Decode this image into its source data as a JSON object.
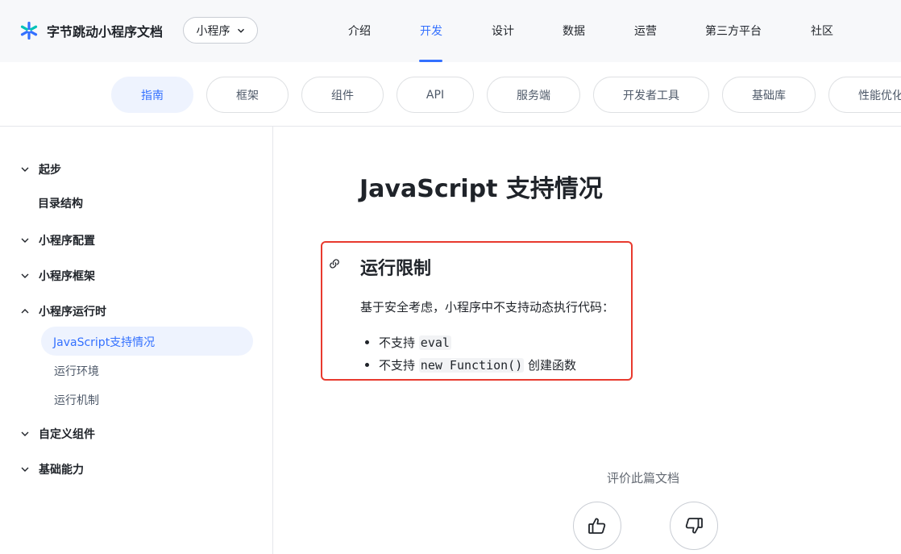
{
  "header": {
    "logo_text": "字节跳动小程序文档",
    "product_select": "小程序",
    "nav": [
      "介绍",
      "开发",
      "设计",
      "数据",
      "运营",
      "第三方平台",
      "社区"
    ],
    "active_nav": "开发"
  },
  "subnav": {
    "items": [
      "指南",
      "框架",
      "组件",
      "API",
      "服务端",
      "开发者工具",
      "基础库",
      "性能优化"
    ],
    "active": "指南"
  },
  "sidebar": {
    "sections": [
      {
        "label": "起步",
        "expanded": true
      },
      {
        "label": "目录结构",
        "expanded": null
      },
      {
        "label": "小程序配置",
        "expanded": false
      },
      {
        "label": "小程序框架",
        "expanded": false
      },
      {
        "label": "小程序运行时",
        "expanded": true
      },
      {
        "label": "自定义组件",
        "expanded": false
      },
      {
        "label": "基础能力",
        "expanded": false
      }
    ],
    "runtime_children": [
      "JavaScript支持情况",
      "运行环境",
      "运行机制"
    ],
    "active_item": "JavaScript支持情况"
  },
  "content": {
    "title": "JavaScript 支持情况",
    "section_title": "运行限制",
    "section_desc": "基于安全考虑，小程序中不支持动态执行代码：",
    "bullets": [
      {
        "prefix": "不支持",
        "code": "eval",
        "suffix": ""
      },
      {
        "prefix": "不支持",
        "code": "new Function()",
        "suffix": "创建函数"
      }
    ]
  },
  "feedback": {
    "label": "评价此篇文档"
  },
  "colors": {
    "accent": "#3370ff",
    "highlight_border": "#e83a2e"
  },
  "icons": {
    "logo": "bytedance-star-icon",
    "select_chevron": "chevron-down-icon",
    "anchor": "link-icon",
    "like": "thumbs-up-icon",
    "dislike": "thumbs-down-icon"
  }
}
